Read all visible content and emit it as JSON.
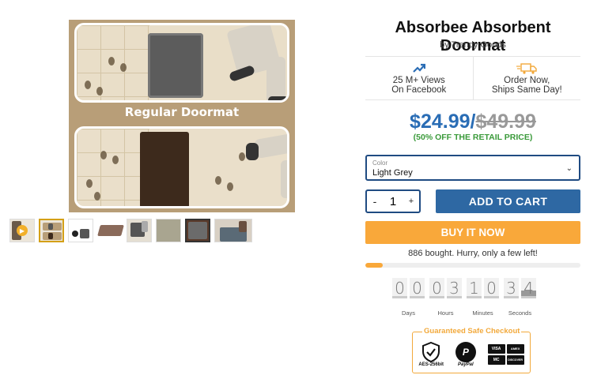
{
  "product": {
    "title": "Absorbee Absorbent Doormat",
    "byline": "by Trendy Goods",
    "image_caption": "Regular Doormat"
  },
  "features": [
    {
      "icon": "trending-up-icon",
      "line1": "25 M+ Views",
      "line2": "On Facebook"
    },
    {
      "icon": "fast-truck-icon",
      "line1": "Order Now,",
      "line2": "Ships Same Day!"
    }
  ],
  "pricing": {
    "current": "$24.99",
    "separator": "/",
    "original": "$49.99",
    "discount": "(50% OFF THE RETAIL PRICE)"
  },
  "color_select": {
    "label": "Color",
    "value": "Light Grey"
  },
  "quantity": {
    "minus": "-",
    "value": "1",
    "plus": "+"
  },
  "buttons": {
    "add_to_cart": "ADD TO CART",
    "buy_now": "BUY IT NOW"
  },
  "stock": {
    "text": "886 bought. Hurry, only a few left!",
    "progress_fraction": 0.08
  },
  "countdown": {
    "days": [
      "0",
      "0"
    ],
    "hours": [
      "0",
      "3"
    ],
    "minutes": [
      "1",
      "0"
    ],
    "seconds": [
      "3",
      "4"
    ],
    "labels": {
      "days": "Days",
      "hours": "Hours",
      "minutes": "Minutes",
      "seconds": "Seconds"
    }
  },
  "checkout_badge": {
    "title": "Guaranteed Safe Checkout",
    "lock_label": "AES-256bit",
    "paypal_label": "PayPal",
    "cards": [
      "VISA",
      "AMEX",
      "MC",
      "DISCOVER"
    ]
  },
  "colors": {
    "accent_blue": "#2e68a3",
    "price_blue": "#2a6db5",
    "buy_orange": "#f9a83a",
    "discount_green": "#3a9a3a",
    "badge_orange": "#f2a93b"
  }
}
